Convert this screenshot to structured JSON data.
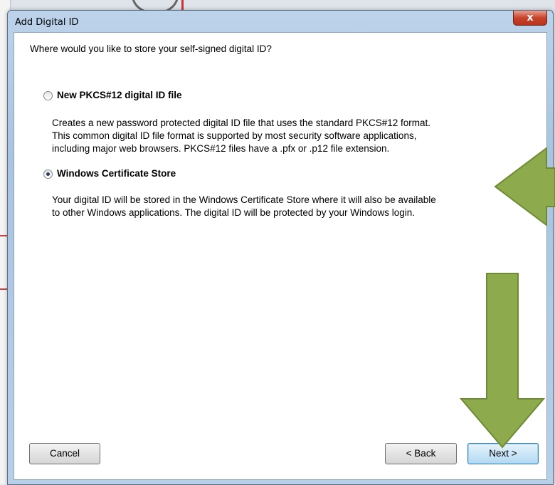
{
  "dialog": {
    "title": "Add Digital ID",
    "close_symbol": "x"
  },
  "content": {
    "question": "Where would you like to store your self-signed digital ID?",
    "options": [
      {
        "label": "New PKCS#12 digital ID file",
        "selected": false,
        "description_lines": [
          "Creates a new password protected digital ID file that uses the standard PKCS#12 format.",
          "This common digital ID file format is supported by most security software applications,",
          "including major web browsers. PKCS#12 files have a .pfx or .p12 file extension."
        ]
      },
      {
        "label": "Windows Certificate Store",
        "selected": true,
        "description_lines": [
          "Your digital ID will be stored in the Windows Certificate Store where it will also be available",
          "to other Windows applications. The digital ID will be protected by your Windows login."
        ]
      }
    ]
  },
  "buttons": {
    "cancel": "Cancel",
    "back": "< Back",
    "next": "Next >"
  },
  "annotations": {
    "arrow_color": "#8dab4c",
    "arrow_stroke": "#6e8a34"
  }
}
